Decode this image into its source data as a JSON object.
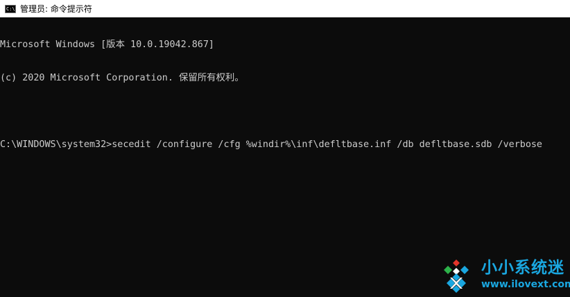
{
  "window": {
    "title": "管理员: 命令提示符",
    "icon": "console-icon",
    "icon_text": "C:\\"
  },
  "console": {
    "lines": [
      "Microsoft Windows [版本 10.0.19042.867]",
      "(c) 2020 Microsoft Corporation. 保留所有权利。",
      "",
      "C:\\WINDOWS\\system32>secedit /configure /cfg %windir%\\inf\\defltbase.inf /db defltbase.sdb /verbose"
    ]
  },
  "watermark": {
    "title": "小小系统迷",
    "url": "www.ilovext.com",
    "color": "#1aa7e0",
    "accent_colors": [
      "#e5342b",
      "#2db34a",
      "#1aa7e0"
    ]
  },
  "colors": {
    "background": "#0c0c0c",
    "text": "#cccccc",
    "titlebar": "#ffffff"
  }
}
